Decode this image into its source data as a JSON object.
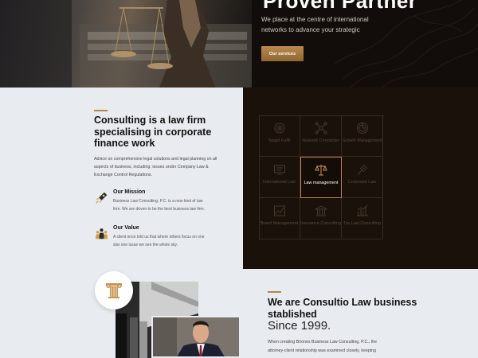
{
  "hero": {
    "title": "Proven Partner",
    "text": "We place at the centre of international networks to advance your strategic",
    "button_label": "Our services"
  },
  "about": {
    "title": "Consulting is a law firm specialising in corporate finance work",
    "description": "Advice on comprehensive legal solutions and legal planning on all aspects of business, including: issues under Company Law & Exchange Control Regulations.",
    "mission": {
      "title": "Our Mission",
      "text": "Business Law Consulting, P.C. is a new kind of law firm. We are driven to be the best business law firm."
    },
    "value": {
      "title": "Our Value",
      "text": "A client once told us that where others focus on one star one issue we see the whole sky."
    }
  },
  "services": [
    {
      "label": "Target Fulfil",
      "icon": "target-icon"
    },
    {
      "label": "Network Connecter",
      "icon": "network-icon"
    },
    {
      "label": "Growth Management",
      "icon": "growth-icon"
    },
    {
      "label": "International Law",
      "icon": "international-icon"
    },
    {
      "label": "Law management",
      "icon": "scales-icon",
      "active": true
    },
    {
      "label": "Corporate Law",
      "icon": "corporate-icon"
    },
    {
      "label": "Brand Management",
      "icon": "chart-icon"
    },
    {
      "label": "Insurance Consulting",
      "icon": "bank-icon"
    },
    {
      "label": "Tax Law Consulting",
      "icon": "bar-chart-icon"
    }
  ],
  "about2": {
    "title": "We are Consultio Law business stablished",
    "subtitle": "Since 1999.",
    "text": "When creating Briones Business Law Consulting, P.C., the attorney-client relationship was examined closely, keeping"
  },
  "colors": {
    "accent": "#b5854b",
    "dark": "#1a110b",
    "light": "#e8ebf0"
  }
}
